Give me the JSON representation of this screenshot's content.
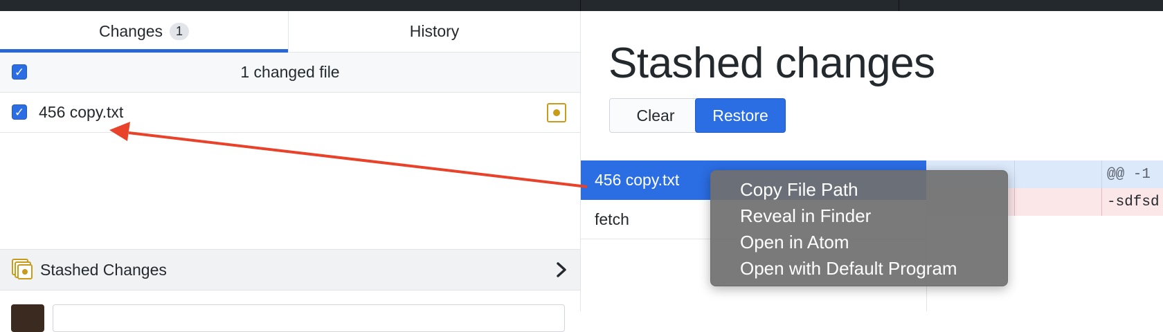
{
  "left_pane": {
    "tabs": [
      {
        "label": "Changes",
        "badge": "1"
      },
      {
        "label": "History"
      }
    ],
    "changed_files_header": "1 changed file",
    "files": [
      {
        "name": "456 copy.txt",
        "status_icon": "modified-icon"
      }
    ],
    "stash_bar": {
      "label": "Stashed Changes",
      "icon": "stash-icon",
      "chevron": "chevron-right-icon"
    }
  },
  "right_pane": {
    "title": "Stashed changes",
    "buttons": {
      "clear": "Clear",
      "restore": "Restore"
    },
    "stash_files": [
      "456 copy.txt",
      "fetch"
    ],
    "diff_lines": [
      "@@ -1",
      "-sdfsd"
    ]
  },
  "context_menu": {
    "items": [
      "Copy File Path",
      "Reveal in Finder",
      "Open in Atom",
      "Open with Default Program"
    ]
  },
  "colors": {
    "accent": "#2b6de3",
    "annotation_arrow": "#e8432a",
    "modified": "#c99b1b"
  }
}
